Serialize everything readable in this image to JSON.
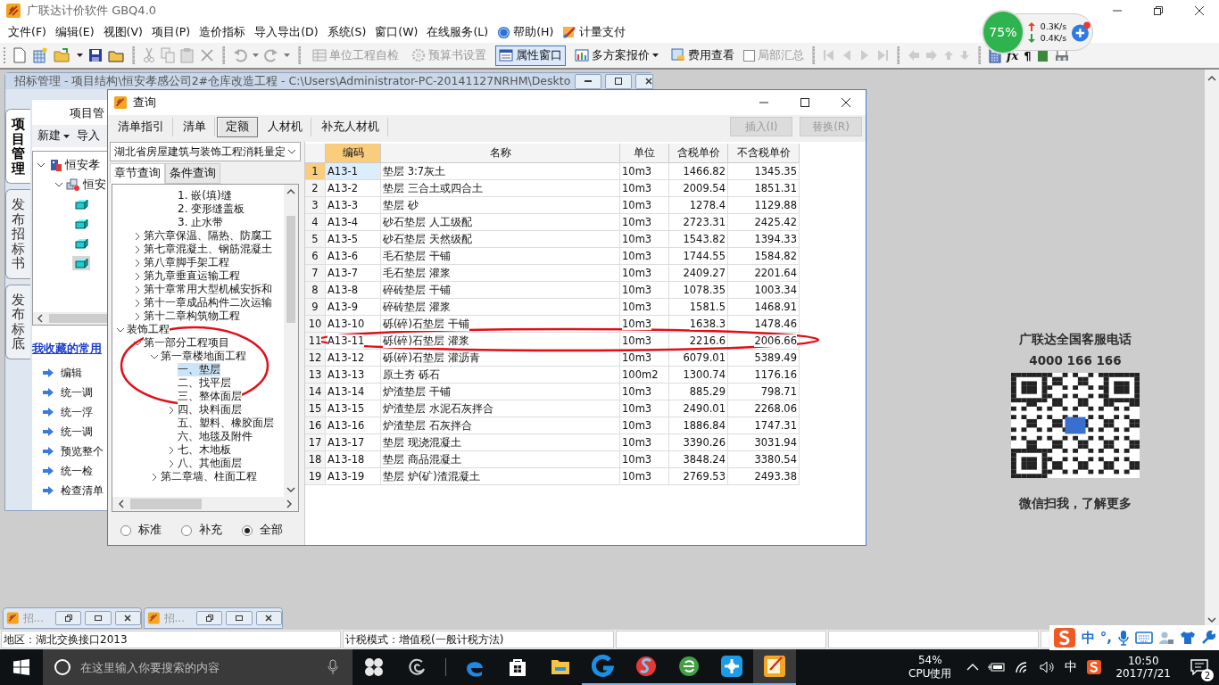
{
  "window": {
    "title": "广联达计价软件 GBQ4.0"
  },
  "menu": [
    {
      "label": "文件(F)",
      "kind": "plain"
    },
    {
      "label": "编辑(E)",
      "kind": "plain"
    },
    {
      "label": "视图(V)",
      "kind": "plain"
    },
    {
      "label": "项目(P)",
      "kind": "plain"
    },
    {
      "label": "造价指标",
      "kind": "plain"
    },
    {
      "label": "导入导出(D)",
      "kind": "plain"
    },
    {
      "label": "系统(S)",
      "kind": "plain"
    },
    {
      "label": "窗口(W)",
      "kind": "plain"
    },
    {
      "label": "在线服务(L)",
      "kind": "plain"
    },
    {
      "label": "帮助(H)",
      "kind": "help"
    },
    {
      "label": "计量支付",
      "kind": "payment"
    }
  ],
  "toolbar": {
    "buttons": [
      {
        "label": "单位工程自检",
        "disabled": true,
        "pressed": false
      },
      {
        "label": "预算书设置",
        "disabled": true,
        "pressed": false
      },
      {
        "label": "属性窗口",
        "disabled": false,
        "pressed": true
      },
      {
        "label": "多方案报价",
        "disabled": false,
        "pressed": false
      },
      {
        "label": "费用查看",
        "disabled": false,
        "pressed": false
      }
    ],
    "checkbox": {
      "label": "局部汇总",
      "checked": false,
      "disabled": true
    },
    "symbols": [
      "fx",
      "¶"
    ]
  },
  "network_meter": {
    "percent": "75%",
    "upload": "0.3K/s",
    "download": "0.4K/s"
  },
  "background_window": {
    "title": "招标管理 - 项目结构\\恒安孝感公司2#仓库改造工程 - C:\\Users\\Administrator-PC-20141127NRHM\\Deskto",
    "side_tabs": [
      {
        "label": "项目管理",
        "selected": true
      },
      {
        "label": "发布招标书",
        "selected": false
      },
      {
        "label": "发布标底",
        "selected": false
      }
    ],
    "heading": "项目管",
    "actions": [
      "新建",
      "导入"
    ],
    "tree": [
      {
        "label": "恒安孝",
        "kind": "company",
        "selected": false,
        "expanded": true,
        "children": [
          {
            "label": "恒安",
            "kind": "project",
            "selected": false,
            "expanded": true,
            "children": [
              {
                "kind": "unit",
                "selected": false
              },
              {
                "kind": "unit",
                "selected": false
              },
              {
                "kind": "unit",
                "selected": false
              },
              {
                "kind": "unit",
                "selected": true
              }
            ]
          }
        ]
      }
    ],
    "favorites": {
      "title": "我收藏的常用",
      "items": [
        "编辑",
        "统一调",
        "统一浮",
        "统一调",
        "预览整个",
        "统一检",
        "检查清单"
      ]
    }
  },
  "query_dialog": {
    "title": "查询",
    "tabs": [
      {
        "label": "清单指引",
        "selected": false
      },
      {
        "label": "清单",
        "selected": false
      },
      {
        "label": "定额",
        "selected": true
      },
      {
        "label": "人材机",
        "selected": false
      },
      {
        "label": "补充人材机",
        "selected": false
      }
    ],
    "actions": [
      {
        "label": "插入(I)",
        "disabled": true
      },
      {
        "label": "替换(R)",
        "disabled": true
      }
    ],
    "library": "湖北省房屋建筑与装饰工程消耗量定",
    "search_tabs": [
      {
        "label": "章节查询",
        "selected": true
      },
      {
        "label": "条件查询",
        "selected": false
      }
    ],
    "tree": [
      {
        "children": [
          {
            "children": [
              {
                "children": [
                  {
                    "label": "1. 嵌(填)缝",
                    "selected": false
                  },
                  {
                    "label": "2. 变形缝盖板",
                    "selected": false
                  },
                  {
                    "label": "3. 止水带",
                    "selected": false
                  }
                ]
              }
            ]
          },
          {
            "label": "第六章保温、隔热、防腐工",
            "selected": false,
            "expanded": false
          },
          {
            "label": "第七章混凝土、钢筋混凝土",
            "selected": false,
            "expanded": false
          },
          {
            "label": "第八章脚手架工程",
            "selected": false,
            "expanded": false
          },
          {
            "label": "第九章垂直运输工程",
            "selected": false,
            "expanded": false
          },
          {
            "label": "第十章常用大型机械安拆和",
            "selected": false,
            "expanded": false
          },
          {
            "label": "第十一章成品构件二次运输",
            "selected": false,
            "expanded": false
          },
          {
            "label": "第十二章构筑物工程",
            "selected": false,
            "expanded": false
          }
        ]
      },
      {
        "label": "装饰工程",
        "selected": false,
        "expanded": true,
        "children": [
          {
            "label": "第一部分工程项目",
            "selected": false,
            "expanded": true,
            "children": [
              {
                "label": "第一章楼地面工程",
                "selected": false,
                "expanded": true,
                "children": [
                  {
                    "label": "一、垫层",
                    "selected": true
                  },
                  {
                    "label": "二、找平层",
                    "selected": false
                  },
                  {
                    "label": "三、整体面层",
                    "selected": false
                  },
                  {
                    "label": "四、块料面层",
                    "selected": false,
                    "expanded": false
                  },
                  {
                    "label": "五、塑料、橡胶面层",
                    "selected": false
                  },
                  {
                    "label": "六、地毯及附件",
                    "selected": false
                  },
                  {
                    "label": "七、木地板",
                    "selected": false,
                    "expanded": false
                  },
                  {
                    "label": "八、其他面层",
                    "selected": false,
                    "expanded": false
                  }
                ]
              },
              {
                "label": "第二章墙、柱面工程",
                "selected": false,
                "expanded": false
              }
            ]
          }
        ]
      }
    ],
    "filters": [
      {
        "label": "标准",
        "selected": false
      },
      {
        "label": "补充",
        "selected": false
      },
      {
        "label": "全部",
        "selected": true
      }
    ],
    "table": {
      "columns": [
        "编码",
        "名称",
        "单位",
        "含税单价",
        "不含税单价"
      ],
      "rows": [
        {
          "index": "1",
          "code": "A13-1",
          "name": "垫层 3:7灰土",
          "unit": "10m3",
          "tax_price": "1466.82",
          "net_price": "1345.35",
          "selected": true
        },
        {
          "index": "2",
          "code": "A13-2",
          "name": "垫层 三合土或四合土",
          "unit": "10m3",
          "tax_price": "2009.54",
          "net_price": "1851.31",
          "selected": false
        },
        {
          "index": "3",
          "code": "A13-3",
          "name": "垫层 砂",
          "unit": "10m3",
          "tax_price": "1278.4",
          "net_price": "1129.88",
          "selected": false
        },
        {
          "index": "4",
          "code": "A13-4",
          "name": "砂石垫层 人工级配",
          "unit": "10m3",
          "tax_price": "2723.31",
          "net_price": "2425.42",
          "selected": false
        },
        {
          "index": "5",
          "code": "A13-5",
          "name": "砂石垫层 天然级配",
          "unit": "10m3",
          "tax_price": "1543.82",
          "net_price": "1394.33",
          "selected": false
        },
        {
          "index": "6",
          "code": "A13-6",
          "name": "毛石垫层 干铺",
          "unit": "10m3",
          "tax_price": "1744.55",
          "net_price": "1584.82",
          "selected": false
        },
        {
          "index": "7",
          "code": "A13-7",
          "name": "毛石垫层 灌浆",
          "unit": "10m3",
          "tax_price": "2409.27",
          "net_price": "2201.64",
          "selected": false
        },
        {
          "index": "8",
          "code": "A13-8",
          "name": "碎砖垫层 干铺",
          "unit": "10m3",
          "tax_price": "1078.35",
          "net_price": "1003.34",
          "selected": false
        },
        {
          "index": "9",
          "code": "A13-9",
          "name": "碎砖垫层 灌浆",
          "unit": "10m3",
          "tax_price": "1581.5",
          "net_price": "1468.91",
          "selected": false
        },
        {
          "index": "10",
          "code": "A13-10",
          "name": "砾(碎)石垫层 干铺",
          "unit": "10m3",
          "tax_price": "1638.3",
          "net_price": "1478.46",
          "selected": false
        },
        {
          "index": "11",
          "code": "A13-11",
          "name": "砾(碎)石垫层 灌浆",
          "unit": "10m3",
          "tax_price": "2216.6",
          "net_price": "2006.66",
          "selected": false
        },
        {
          "index": "12",
          "code": "A13-12",
          "name": "砾(碎)石垫层 灌沥青",
          "unit": "10m3",
          "tax_price": "6079.01",
          "net_price": "5389.49",
          "selected": false
        },
        {
          "index": "13",
          "code": "A13-13",
          "name": "原土夯 砾石",
          "unit": "100m2",
          "tax_price": "1300.74",
          "net_price": "1176.16",
          "selected": false
        },
        {
          "index": "14",
          "code": "A13-14",
          "name": "炉渣垫层 干铺",
          "unit": "10m3",
          "tax_price": "885.29",
          "net_price": "798.71",
          "selected": false
        },
        {
          "index": "15",
          "code": "A13-15",
          "name": "炉渣垫层 水泥石灰拌合",
          "unit": "10m3",
          "tax_price": "2490.01",
          "net_price": "2268.06",
          "selected": false
        },
        {
          "index": "16",
          "code": "A13-16",
          "name": "炉渣垫层 石灰拌合",
          "unit": "10m3",
          "tax_price": "1886.84",
          "net_price": "1747.31",
          "selected": false
        },
        {
          "index": "17",
          "code": "A13-17",
          "name": "垫层 现浇混凝土",
          "unit": "10m3",
          "tax_price": "3390.26",
          "net_price": "3031.94",
          "selected": false
        },
        {
          "index": "18",
          "code": "A13-18",
          "name": "垫层 商品混凝土",
          "unit": "10m3",
          "tax_price": "3848.24",
          "net_price": "3380.54",
          "selected": false
        },
        {
          "index": "19",
          "code": "A13-19",
          "name": "垫层 炉(矿)渣混凝土",
          "unit": "10m3",
          "tax_price": "2769.53",
          "net_price": "2493.38",
          "selected": false
        }
      ]
    }
  },
  "service": {
    "title": "广联达全国客服电话",
    "phone": "4000 166 166",
    "caption": "微信扫我，了解更多"
  },
  "minimized_windows": [
    {
      "title": "招..."
    },
    {
      "title": "招..."
    }
  ],
  "status_bar": [
    "地区：湖北交换接口2013",
    "计税模式：增值税(一般计税方法)"
  ],
  "ime_bar": {
    "mode": "中",
    "punctuation": "°,"
  },
  "taskbar": {
    "search_placeholder": "在这里输入你要搜索的内容",
    "apps": [
      {
        "kind": "fan",
        "running": false,
        "selected": false
      },
      {
        "kind": "swirl",
        "running": false,
        "selected": false
      },
      {
        "kind": "edge",
        "running": false,
        "selected": false
      },
      {
        "kind": "store",
        "running": false,
        "selected": false
      },
      {
        "kind": "explorer",
        "running": false,
        "selected": false
      },
      {
        "kind": "g-app",
        "running": true,
        "selected": false
      },
      {
        "kind": "s-app",
        "running": true,
        "selected": false
      },
      {
        "kind": "globe",
        "running": true,
        "selected": false
      },
      {
        "kind": "plus",
        "running": true,
        "selected": false
      },
      {
        "kind": "notepad",
        "running": true,
        "selected": true
      }
    ],
    "cpu": "54%",
    "cpu_label": "CPU使用",
    "ime": "中",
    "time": "10:50",
    "date": "2017/7/21",
    "notifications": "2"
  }
}
